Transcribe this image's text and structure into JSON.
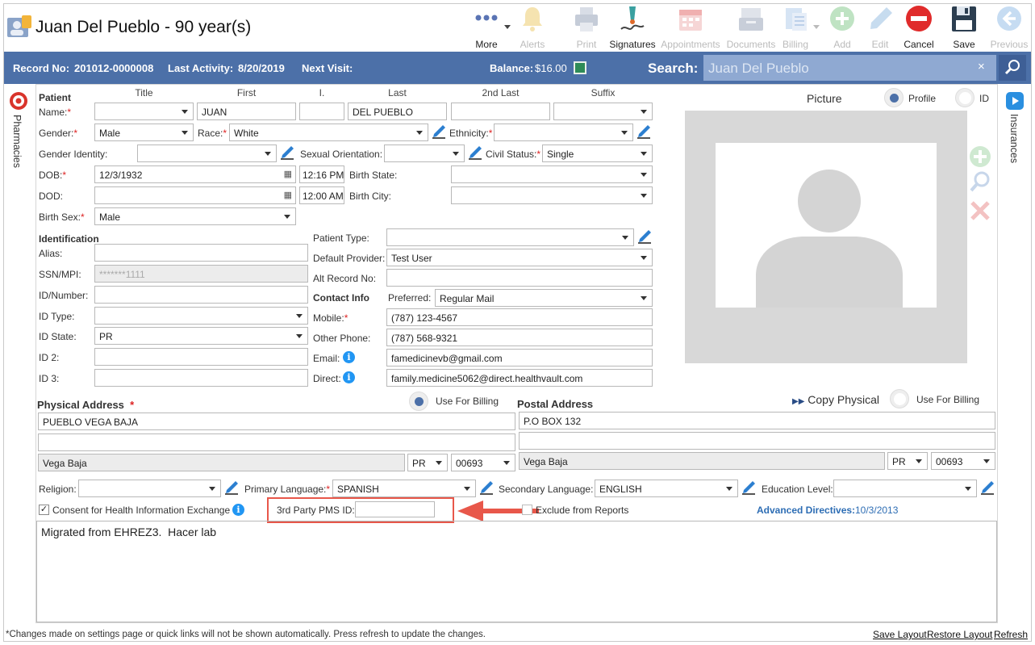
{
  "header": {
    "patient_title": "Juan Del Pueblo - 90 year(s)"
  },
  "toolbar": [
    {
      "name": "more",
      "label": "More",
      "icon": "more-dots-icon",
      "enabled": true
    },
    {
      "name": "alerts",
      "label": "Alerts",
      "icon": "bell-icon",
      "enabled": false
    },
    {
      "name": "print",
      "label": "Print",
      "icon": "printer-icon",
      "enabled": false
    },
    {
      "name": "signatures",
      "label": "Signatures",
      "icon": "pen-signature-icon",
      "enabled": true
    },
    {
      "name": "appointments",
      "label": "Appointments",
      "icon": "calendar-icon",
      "enabled": false
    },
    {
      "name": "documents",
      "label": "Documents",
      "icon": "tray-icon",
      "enabled": false
    },
    {
      "name": "billing",
      "label": "Billing",
      "icon": "billing-icon",
      "enabled": false
    },
    {
      "name": "add",
      "label": "Add",
      "icon": "plus-circle-icon",
      "enabled": false
    },
    {
      "name": "edit",
      "label": "Edit",
      "icon": "pencil-icon",
      "enabled": false
    },
    {
      "name": "cancel",
      "label": "Cancel",
      "icon": "cancel-circle-icon",
      "enabled": true
    },
    {
      "name": "save",
      "label": "Save",
      "icon": "floppy-icon",
      "enabled": true
    },
    {
      "name": "previous",
      "label": "Previous",
      "icon": "back-arrow-icon",
      "enabled": false
    }
  ],
  "infobar": {
    "record_label": "Record No:",
    "record_value": "201012-0000008",
    "activity_label": "Last Activity:",
    "activity_value": "8/20/2019",
    "next_visit_label": "Next Visit:",
    "balance_label": "Balance:",
    "balance_value": "$16.00",
    "search_label": "Search:",
    "search_value": "Juan Del Pueblo",
    "clear": "×"
  },
  "side": {
    "left": "Pharmacies",
    "right": "Insurances"
  },
  "patient": {
    "section": "Patient",
    "col_title": "Title",
    "col_first": "First",
    "col_initial": "I.",
    "col_last": "Last",
    "col_last2": "2nd Last",
    "col_suffix": "Suffix",
    "name_label": "Name:",
    "first": "JUAN",
    "last": "DEL PUEBLO",
    "gender_label": "Gender:",
    "gender": "Male",
    "race_label": "Race:",
    "race": "White",
    "ethnicity_label": "Ethnicity:",
    "gender_identity_label": "Gender Identity:",
    "orientation_label": "Sexual Orientation:",
    "civil_label": "Civil Status:",
    "civil": "Single",
    "dob_label": "DOB:",
    "dob": "12/3/1932",
    "dob_time": "12:16 PM",
    "birth_state_label": "Birth State:",
    "dod_label": "DOD:",
    "dod_time": "12:00 AM",
    "birth_city_label": "Birth City:",
    "birth_sex_label": "Birth Sex:",
    "birth_sex": "Male"
  },
  "identification": {
    "section": "Identification",
    "alias_label": "Alias:",
    "ssn_label": "SSN/MPI:",
    "ssn": "*******1111",
    "idnum_label": "ID/Number:",
    "idtype_label": "ID Type:",
    "idstate_label": "ID State:",
    "idstate": "PR",
    "id2_label": "ID 2:",
    "id3_label": "ID 3:"
  },
  "misc": {
    "patient_type_label": "Patient Type:",
    "provider_label": "Default Provider:",
    "provider": "Test User",
    "alt_label": "Alt Record No:",
    "contact_section": "Contact Info",
    "preferred_label": "Preferred:",
    "preferred": "Regular Mail",
    "mobile_label": "Mobile:",
    "mobile": "(787) 123-4567",
    "other_label": "Other Phone:",
    "other": "(787) 568-9321",
    "email_label": "Email:",
    "email": "famedicinevb@gmail.com",
    "direct_label": "Direct:",
    "direct": "family.medicine5062@direct.healthvault.com"
  },
  "picture": {
    "label": "Picture",
    "profile": "Profile",
    "id": "ID"
  },
  "physical": {
    "section": "Physical Address",
    "line1": "PUEBLO VEGA BAJA",
    "city": "Vega Baja",
    "state": "PR",
    "zip": "00693",
    "billing": "Use For Billing"
  },
  "postal": {
    "section": "Postal Address",
    "copy": "Copy Physical",
    "line1": "P.O BOX 132",
    "city": "Vega Baja",
    "state": "PR",
    "zip": "00693",
    "billing": "Use For Billing"
  },
  "bottom": {
    "religion_label": "Religion:",
    "primary_label": "Primary Language:",
    "primary": "SPANISH",
    "secondary_label": "Secondary Language:",
    "secondary": "ENGLISH",
    "education_label": "Education Level:",
    "consent": "Consent for Health Information Exchange",
    "pms_label": "3rd Party PMS ID:",
    "exclude": "Exclude from Reports",
    "advdir_label": "Advanced Directives:",
    "advdir_value": "10/3/2013",
    "notes": "Migrated from EHREZ3.  Hacer lab"
  },
  "footer": {
    "note": "*Changes made on settings page or quick links will not be shown automatically. Press refresh to update the changes.",
    "save_layout": "Save Layout",
    "restore_layout": "Restore Layout",
    "refresh": "Refresh"
  },
  "colors": {
    "header_bar": "#4c70a8",
    "highlight": "#e8574a",
    "link": "#2d6db4"
  }
}
